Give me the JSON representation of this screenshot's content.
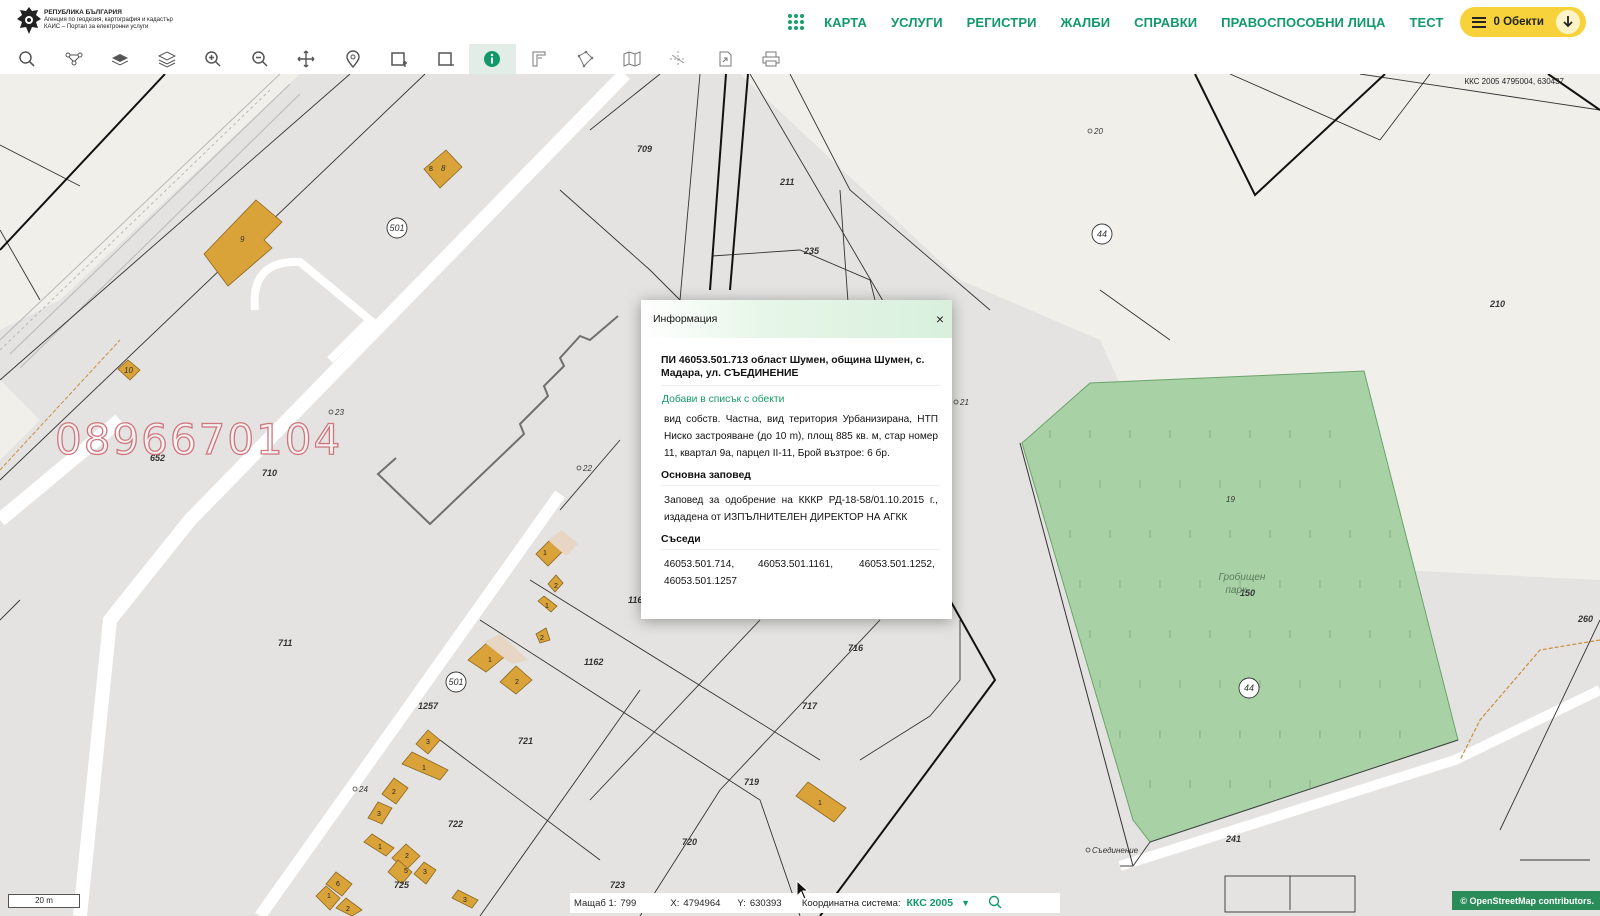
{
  "header": {
    "logo_line1": "РЕПУБЛИКА БЪЛГАРИЯ",
    "logo_line2": "Агенция по геодезия, картография и кадастър",
    "logo_line3": "КАИС – Портал за електронни услуги",
    "nav": [
      "КАРТА",
      "УСЛУГИ",
      "РЕГИСТРИ",
      "ЖАЛБИ",
      "СПРАВКИ",
      "ПРАВОСПОСОБНИ ЛИЦА",
      "ТЕСТ"
    ],
    "cart_label": "0 Обекти"
  },
  "toolbar": {
    "tools": [
      "search-icon",
      "route-icon",
      "layer-single-icon",
      "layers-icon",
      "zoom-in-icon",
      "zoom-out-icon",
      "pan-icon",
      "pin-icon",
      "select-rect-icon",
      "deselect-rect-icon",
      "info-icon",
      "measure-icon",
      "polygon-icon",
      "map-icon",
      "split-icon",
      "export-icon",
      "print-icon"
    ],
    "active_tool": "info-icon",
    "accent_color": "#12996a"
  },
  "info_panel": {
    "header": "Информация",
    "title": "ПИ 46053.501.713 област Шумен, община Шумен, с. Мадара, ул. СЪЕДИНЕНИЕ",
    "add_link": "Добави в списък с обекти",
    "description": "вид собств. Частна, вид територия Урбанизирана, НТП Ниско застрояване (до 10 m), площ 885 кв. м, стар номер 11, квартал 9а, парцел II-11, Брой възтрое: 6 бр.",
    "order_heading": "Основна заповед",
    "order_text": "Заповед за одобрение на КККР РД-18-58/01.10.2015 г., издадена от ИЗПЪЛНИТЕЛЕН ДИРЕКТОР НА АГКК",
    "neighbors_heading": "Съседи",
    "neighbors": [
      "46053.501.714,",
      "46053.501.1161,",
      "46053.501.1252,",
      "46053.501.1257"
    ]
  },
  "status_bar": {
    "scale_label": "Мащаб 1:",
    "scale_value": "799",
    "x_label": "X:",
    "x_value": "4794964",
    "y_label": "Y:",
    "y_value": "630393",
    "system_label": "Координатна система:",
    "system_value": "ККС 2005"
  },
  "map": {
    "coord_top": "ККС 2005 4795004, 630437",
    "scale_bar": "20 m",
    "attribution": "© OpenStreetMap contributors.",
    "watermark": "0896670104",
    "parcel_labels": [
      "709",
      "211",
      "235",
      "210",
      "501",
      "711",
      "710",
      "652",
      "1162",
      "1257",
      "721",
      "722",
      "725",
      "723",
      "720",
      "719",
      "717",
      "716",
      "241",
      "260",
      "116",
      "8",
      "9",
      "10",
      "Гробищен",
      "парк",
      "150",
      "25",
      "44",
      "19",
      "20",
      "21",
      "22",
      "23",
      "24",
      "Съединение"
    ]
  }
}
